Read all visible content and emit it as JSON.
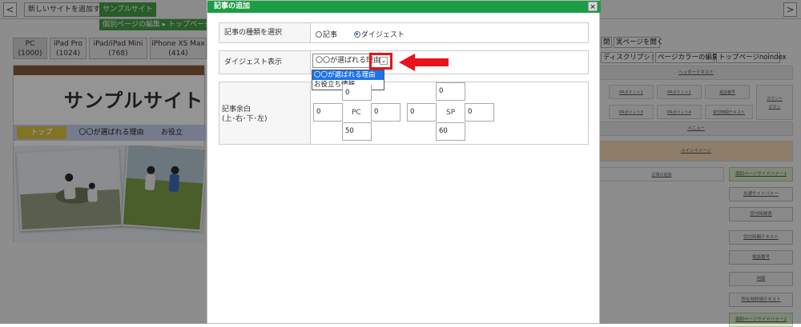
{
  "topbar": {
    "back": "<",
    "forward": ">",
    "add_site": "新しいサイトを追加する",
    "site_name": "サンプルサイト",
    "breadcrumb": "個別ページの編集 ▸ トップページ編"
  },
  "devices": [
    {
      "name": "PC",
      "width": "(1000)"
    },
    {
      "name": "iPad Pro",
      "width": "(1024)"
    },
    {
      "name": "iPad/iPad Mini",
      "width": "(768)"
    },
    {
      "name": "iPhone XS Max",
      "width": "(414)"
    }
  ],
  "right_tabs": {
    "close": "閉",
    "open_page": "実ページを開く",
    "description": "ディスクリプション",
    "color": "ページカラーの編集",
    "noindex": "トップページnoindex"
  },
  "preview": {
    "title": "サンプルサイト",
    "nav": [
      "トップ",
      "〇〇が選ばれる理由",
      "お役立"
    ]
  },
  "right_panel": {
    "header_text": "ヘッダーテキスト",
    "row1": [
      "PRポイント1",
      "PRポイント2",
      "電話番号",
      "受付時間"
    ],
    "row2": [
      "PRポイント3",
      "PRポイント4",
      "受付時間テキスト"
    ],
    "side_top": [
      "カウント",
      "ボタン"
    ],
    "menu": "メニュー",
    "main_image": "メインイメージ",
    "add_article": "記事の追加",
    "side_buttons": [
      "個別ページサイドバナー1",
      "共通サイドバナー",
      "受付時間表",
      "受付時間テキスト",
      "電話番号",
      "地図",
      "所在地詳細テキスト",
      "個別ページサイドバナー2"
    ]
  },
  "modal": {
    "title": "記事の追加",
    "close_icon": "×",
    "type_label": "記事の種類を選択",
    "type_options": [
      {
        "label": "記事",
        "checked": false
      },
      {
        "label": "ダイジェスト",
        "checked": true
      }
    ],
    "digest_label": "ダイジェスト表示",
    "digest_value": "〇〇が選ばれる理由",
    "dropdown_options": [
      {
        "label": "〇〇が選ばれる理由",
        "highlighted": true
      },
      {
        "label": "お役立ち情報",
        "highlighted": false
      }
    ],
    "margin_label": "記事余白",
    "margin_sub": "(上･右･下･左)",
    "pc": {
      "label": "PC",
      "top": "0",
      "right": "0",
      "bottom": "50",
      "left": "0"
    },
    "sp": {
      "label": "SP",
      "top": "0",
      "right": "0",
      "bottom": "60",
      "left": "0"
    }
  },
  "colors": {
    "accent_green": "#1d9c47",
    "highlight_red": "#e8131b",
    "selection_blue": "#1e74e6"
  }
}
